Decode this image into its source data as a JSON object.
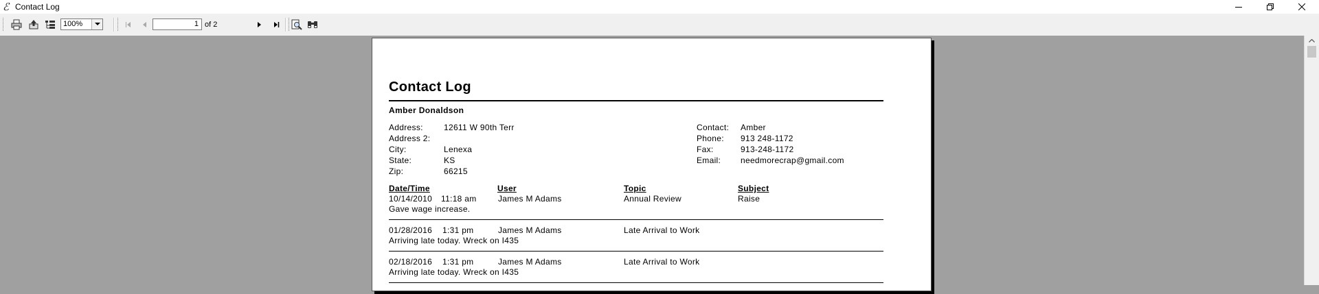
{
  "window": {
    "title": "Contact Log"
  },
  "toolbar": {
    "zoom": "100%",
    "page_number": "1",
    "page_of": "of 2"
  },
  "report": {
    "title": "Contact Log",
    "name": "Amber Donaldson",
    "labels": {
      "address": "Address:",
      "address2": "Address 2:",
      "city": "City:",
      "state": "State:",
      "zip": "Zip:",
      "contact": "Contact:",
      "phone": "Phone:",
      "fax": "Fax:",
      "email": "Email:"
    },
    "address": "12611 W 90th Terr",
    "address2": "",
    "city": "Lenexa",
    "state": "KS",
    "zip": "66215",
    "contact": "Amber",
    "phone": "913 248-1172",
    "fax": "913-248-1172",
    "email": "needmorecrap@gmail.com",
    "columns": {
      "datetime": "Date/Time",
      "user": "User",
      "topic": "Topic",
      "subject": "Subject"
    },
    "entries": [
      {
        "date": "10/14/2010",
        "time": "11:18 am",
        "user": "James M Adams",
        "topic": "Annual Review",
        "subject": "Raise",
        "note": "Gave wage increase."
      },
      {
        "date": "01/28/2016",
        "time": "1:31 pm",
        "user": "James M Adams",
        "topic": "Late Arrival to Work",
        "subject": "",
        "note": "Arriving late today. Wreck on I435"
      },
      {
        "date": "02/18/2016",
        "time": "1:31 pm",
        "user": "James M Adams",
        "topic": "Late Arrival to Work",
        "subject": "",
        "note": "Arriving late today. Wreck on I435"
      }
    ]
  }
}
